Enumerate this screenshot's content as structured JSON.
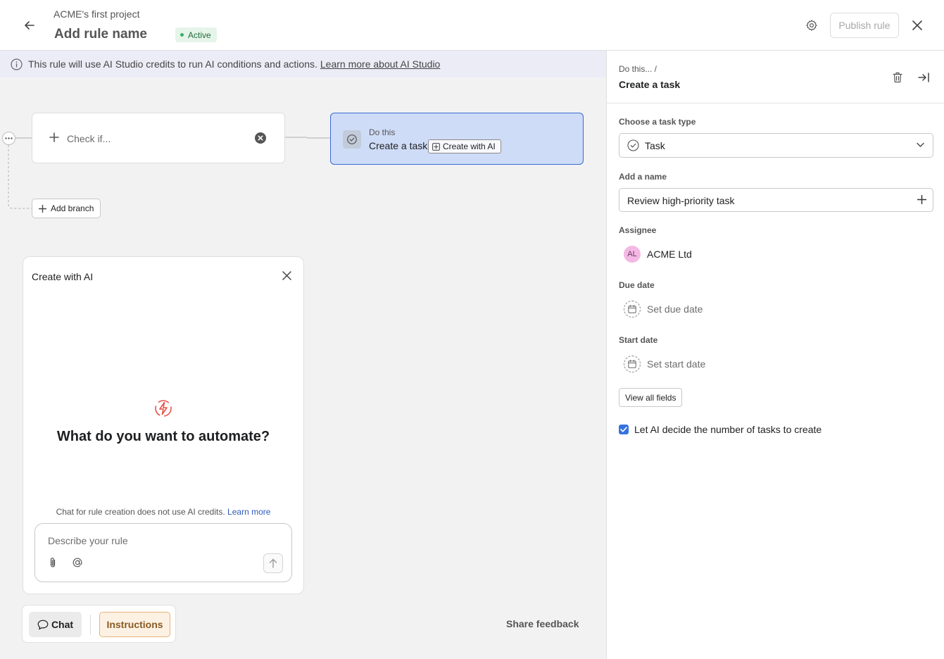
{
  "header": {
    "project_name": "ACME's first project",
    "rule_name": "Add rule name",
    "status": "Active",
    "publish_label": "Publish rule"
  },
  "banner": {
    "text": "This rule will use AI Studio credits to run AI conditions and actions.",
    "link": "Learn more about AI Studio"
  },
  "flow": {
    "check_label": "Check if...",
    "do_this_label": "Do this",
    "action_title": "Create a task",
    "ai_chip_label": "Create with AI",
    "add_branch_label": "Add branch"
  },
  "ai_panel": {
    "title": "Create with AI",
    "headline": "What do you want to automate?",
    "note": "Chat for rule creation does not use AI credits.",
    "note_link": "Learn more",
    "input_placeholder": "Describe your rule"
  },
  "bottom_bar": {
    "chat_label": "Chat",
    "instructions_label": "Instructions",
    "share_feedback": "Share feedback"
  },
  "side_panel": {
    "breadcrumb": "Do this...  /",
    "title": "Create a task",
    "task_type_label": "Choose a task type",
    "task_type_value": "Task",
    "name_label": "Add a name",
    "name_value": "Review high-priority task",
    "assignee_label": "Assignee",
    "assignee_initials": "AL",
    "assignee_name": "ACME Ltd",
    "due_date_label": "Due date",
    "due_date_placeholder": "Set due date",
    "start_date_label": "Start date",
    "start_date_placeholder": "Set start date",
    "view_all_fields": "View all fields",
    "ai_decide_label": "Let AI decide the number of tasks to create",
    "ai_decide_checked": true
  },
  "colors": {
    "accent_blue": "#3573e0",
    "selected_card_bg": "#cfdcf7",
    "status_green": "#35b06a",
    "ai_bolt": "#e8534a",
    "instructions_bg": "#fdf1e3"
  }
}
